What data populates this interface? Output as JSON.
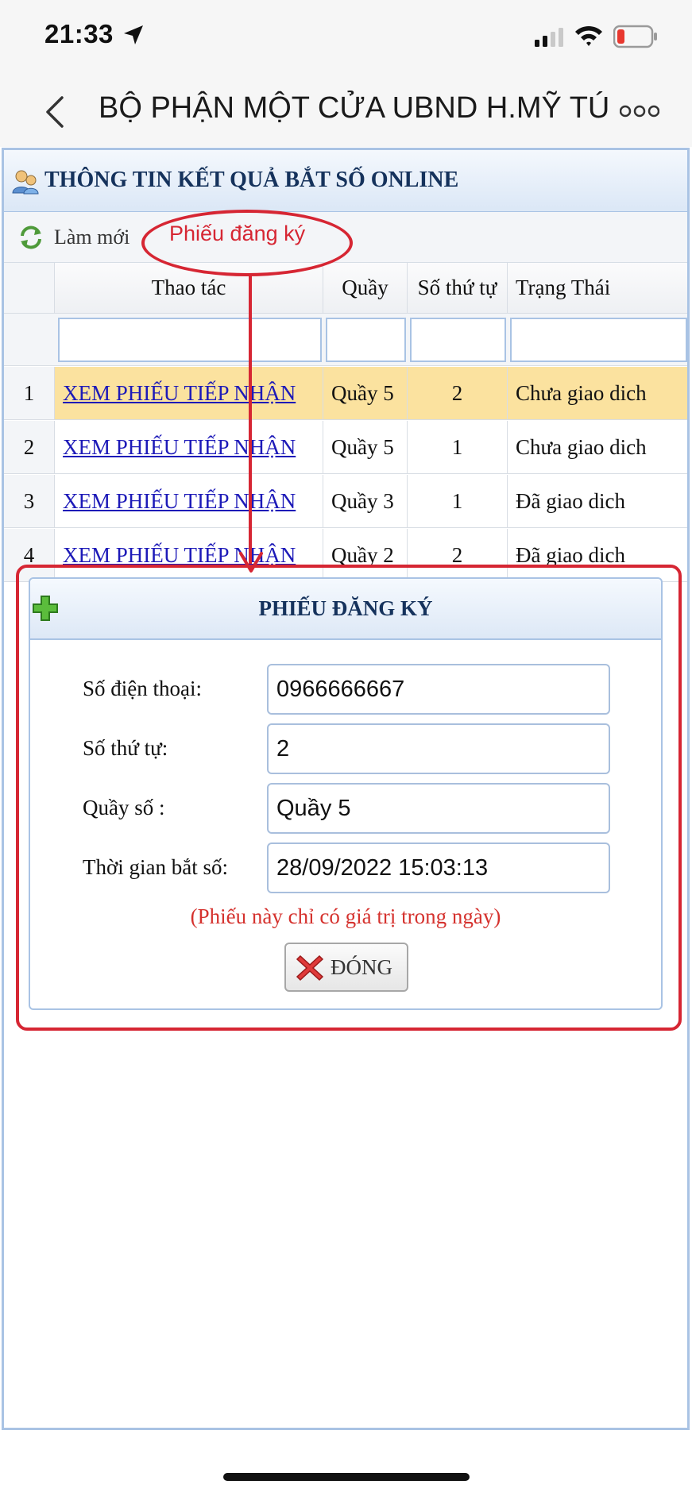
{
  "status_bar": {
    "time": "21:33"
  },
  "nav": {
    "title": "BỘ PHẬN MỘT CỬA UBND H.MỸ TÚ"
  },
  "panel": {
    "title": "THÔNG TIN KẾT QUẢ BẮT SỐ ONLINE",
    "refresh_label": "Làm mới"
  },
  "annotation": {
    "label": "Phiếu đăng ký"
  },
  "table": {
    "columns": [
      "",
      "Thao tác",
      "Quầy",
      "Số thứ tự",
      "Trạng Thái"
    ],
    "rows": [
      {
        "index": "1",
        "action": "XEM PHIẾU TIẾP NHẬN",
        "counter": "Quầy 5",
        "number": "2",
        "status": "Chưa giao dich"
      },
      {
        "index": "2",
        "action": "XEM PHIẾU TIẾP NHẬN",
        "counter": "Quầy 5",
        "number": "1",
        "status": "Chưa giao dich"
      },
      {
        "index": "3",
        "action": "XEM PHIẾU TIẾP NHẬN",
        "counter": "Quầy 3",
        "number": "1",
        "status": "Đã giao dich"
      },
      {
        "index": "4",
        "action": "XEM PHIẾU TIẾP NHẬN",
        "counter": "Quầy 2",
        "number": "2",
        "status": "Đã giao dich"
      }
    ]
  },
  "dialog": {
    "title": "PHIẾU ĐĂNG KÝ",
    "fields": [
      {
        "label": "Số điện thoại:",
        "value": "0966666667"
      },
      {
        "label": "Số thứ tự:",
        "value": "2"
      },
      {
        "label": "Quầy số :",
        "value": "Quầy 5"
      },
      {
        "label": "Thời gian bắt số:",
        "value": "28/09/2022  15:03:13"
      }
    ],
    "note": "(Phiếu này chỉ có giá trị trong ngày)",
    "close_label": "ĐÓNG"
  },
  "colors": {
    "accent_red": "#d62633",
    "link_blue": "#1d1ab8",
    "selected_row": "#fbe29f",
    "header_text": "#15325c"
  }
}
